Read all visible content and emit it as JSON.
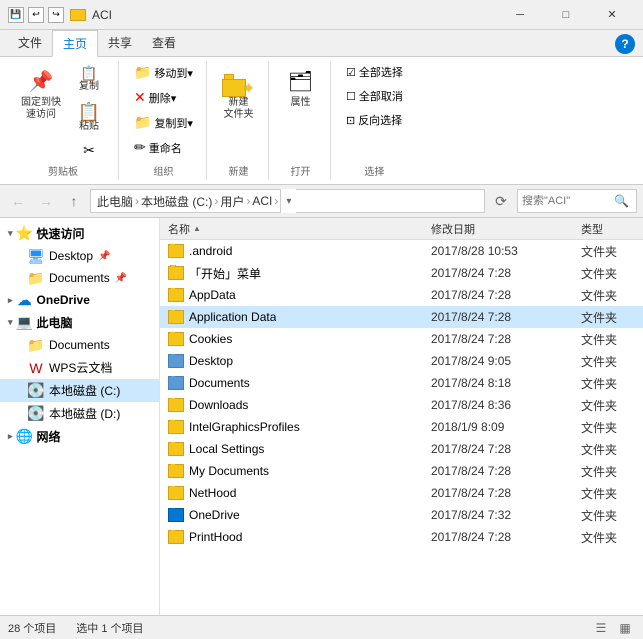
{
  "titleBar": {
    "title": "ACI",
    "controls": [
      "─",
      "□",
      "✕"
    ]
  },
  "ribbonTabs": [
    "文件",
    "主页",
    "共享",
    "查看"
  ],
  "activeTab": "主页",
  "ribbonGroups": [
    {
      "label": "剪贴板",
      "buttons": [
        {
          "id": "pin",
          "icon": "📌",
          "label": "固定到快\n速访问"
        },
        {
          "id": "copy",
          "icon": "📋",
          "label": "复制"
        },
        {
          "id": "paste",
          "icon": "📄",
          "label": "粘贴"
        }
      ]
    },
    {
      "label": "组织",
      "smallButtons": [
        {
          "id": "move",
          "icon": "📁",
          "label": "移动到▾"
        },
        {
          "id": "delete",
          "icon": "✕",
          "label": "删除▾"
        },
        {
          "id": "copy2",
          "icon": "📁",
          "label": "复制到▾"
        },
        {
          "id": "rename",
          "icon": "✏",
          "label": "重命名"
        }
      ]
    },
    {
      "label": "新建",
      "buttons": [
        {
          "id": "newfolder",
          "icon": "folder",
          "label": "新建\n文件夹"
        }
      ]
    },
    {
      "label": "打开",
      "buttons": [
        {
          "id": "properties",
          "icon": "🔲",
          "label": "属性"
        }
      ]
    },
    {
      "label": "选择",
      "smallButtons": [
        {
          "id": "selectall",
          "label": "全部选择"
        },
        {
          "id": "deselectall",
          "label": "全部取消"
        },
        {
          "id": "invertsel",
          "label": "反向选择"
        }
      ]
    }
  ],
  "addressBar": {
    "path": [
      "此电脑",
      "本地磁盘 (C:)",
      "用户",
      "ACI"
    ],
    "searchPlaceholder": "搜索\"ACI\"",
    "searchValue": ""
  },
  "sidebar": {
    "sections": [
      {
        "id": "quickaccess",
        "label": "快速访问",
        "expanded": true,
        "items": [
          {
            "id": "desktop",
            "label": "Desktop",
            "iconColor": "blue"
          },
          {
            "id": "documents",
            "label": "Documents",
            "iconColor": "blue"
          }
        ]
      },
      {
        "id": "onedrive",
        "label": "OneDrive",
        "iconColor": "blue"
      },
      {
        "id": "thispc",
        "label": "此电脑",
        "expanded": true,
        "items": [
          {
            "id": "documents2",
            "label": "Documents",
            "iconColor": "blue"
          },
          {
            "id": "wpsdocs",
            "label": "WPS云文档",
            "iconColor": "gold"
          },
          {
            "id": "localc",
            "label": "本地磁盘 (C:)",
            "iconColor": "gray",
            "selected": true
          },
          {
            "id": "locald",
            "label": "本地磁盘 (D:)",
            "iconColor": "gray"
          }
        ]
      },
      {
        "id": "network",
        "label": "网络",
        "iconColor": "gray"
      }
    ]
  },
  "fileList": {
    "columns": [
      {
        "id": "name",
        "label": "名称",
        "sortable": true
      },
      {
        "id": "date",
        "label": "修改日期"
      },
      {
        "id": "type",
        "label": "类型"
      }
    ],
    "files": [
      {
        "name": ".android",
        "date": "2017/8/28 10:53",
        "type": "文件夹",
        "iconType": "folder",
        "selected": false
      },
      {
        "name": "「开始」菜单",
        "date": "2017/8/24 7:28",
        "type": "文件夹",
        "iconType": "folder",
        "selected": false
      },
      {
        "name": "AppData",
        "date": "2017/8/24 7:28",
        "type": "文件夹",
        "iconType": "folder",
        "selected": false
      },
      {
        "name": "Application Data",
        "date": "2017/8/24 7:28",
        "type": "文件夹",
        "iconType": "folder",
        "selected": true
      },
      {
        "name": "Cookies",
        "date": "2017/8/24 7:28",
        "type": "文件夹",
        "iconType": "folder",
        "selected": false
      },
      {
        "name": "Desktop",
        "date": "2017/8/24 9:05",
        "type": "文件夹",
        "iconType": "folder-blue",
        "selected": false
      },
      {
        "name": "Documents",
        "date": "2017/8/24 8:18",
        "type": "文件夹",
        "iconType": "folder-blue",
        "selected": false
      },
      {
        "name": "Downloads",
        "date": "2017/8/24 8:36",
        "type": "文件夹",
        "iconType": "folder",
        "selected": false
      },
      {
        "name": "IntelGraphicsProfiles",
        "date": "2018/1/9 8:09",
        "type": "文件夹",
        "iconType": "folder",
        "selected": false
      },
      {
        "name": "Local Settings",
        "date": "2017/8/24 7:28",
        "type": "文件夹",
        "iconType": "folder",
        "selected": false
      },
      {
        "name": "My Documents",
        "date": "2017/8/24 7:28",
        "type": "文件夹",
        "iconType": "folder",
        "selected": false
      },
      {
        "name": "NetHood",
        "date": "2017/8/24 7:28",
        "type": "文件夹",
        "iconType": "folder",
        "selected": false
      },
      {
        "name": "OneDrive",
        "date": "2017/8/24 7:32",
        "type": "文件夹",
        "iconType": "folder-onedrive",
        "selected": false
      },
      {
        "name": "PrintHood",
        "date": "2017/8/24 7:28",
        "type": "文件夹",
        "iconType": "folder",
        "selected": false
      }
    ]
  },
  "statusBar": {
    "itemCount": "28 个项目",
    "selectedCount": "选中 1 个项目"
  },
  "icons": {
    "back": "←",
    "forward": "→",
    "up": "↑",
    "refresh": "⟳",
    "search": "🔍",
    "chevronDown": "▾",
    "chevronRight": "▸",
    "sortAsc": "▲",
    "listView": "☰",
    "detailView": "▦"
  }
}
